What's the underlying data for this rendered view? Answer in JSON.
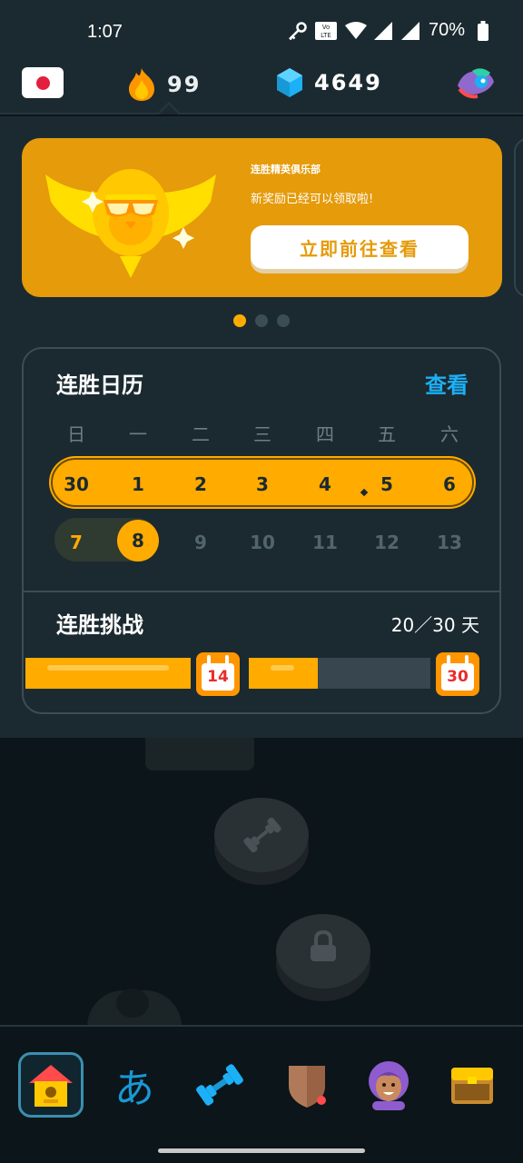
{
  "status_bar": {
    "time": "1:07",
    "battery": "70%",
    "lte_label": "Vo LTE 2"
  },
  "header": {
    "flag": "japan-flag",
    "streak_count": "99",
    "gem_count": "4649"
  },
  "promo": {
    "club_name": "连胜精英俱乐部",
    "message": "新奖励已经可以领取啦!",
    "button_label": "立即前往查看"
  },
  "pager": {
    "pages": 3,
    "active": 0
  },
  "calendar": {
    "title": "连胜日历",
    "view_label": "查看",
    "weekdays": [
      "日",
      "一",
      "二",
      "三",
      "四",
      "五",
      "六"
    ],
    "week1": [
      "30",
      "1",
      "2",
      "3",
      "4",
      "5",
      "6"
    ],
    "week2": [
      "7",
      "8",
      "9",
      "10",
      "11",
      "12",
      "13"
    ],
    "today": "8"
  },
  "challenge": {
    "title": "连胜挑战",
    "progress_text": "20／30 天",
    "progress": 0.667,
    "milestones": [
      "14",
      "30"
    ]
  },
  "bottom_nav": {
    "items": [
      "home",
      "characters",
      "practice",
      "leagues",
      "profile",
      "shop"
    ],
    "active": "home",
    "characters_glyph": "あ"
  },
  "colors": {
    "accent": "#ffab00",
    "blue": "#1cb0f6",
    "bg": "#1b2a30"
  }
}
